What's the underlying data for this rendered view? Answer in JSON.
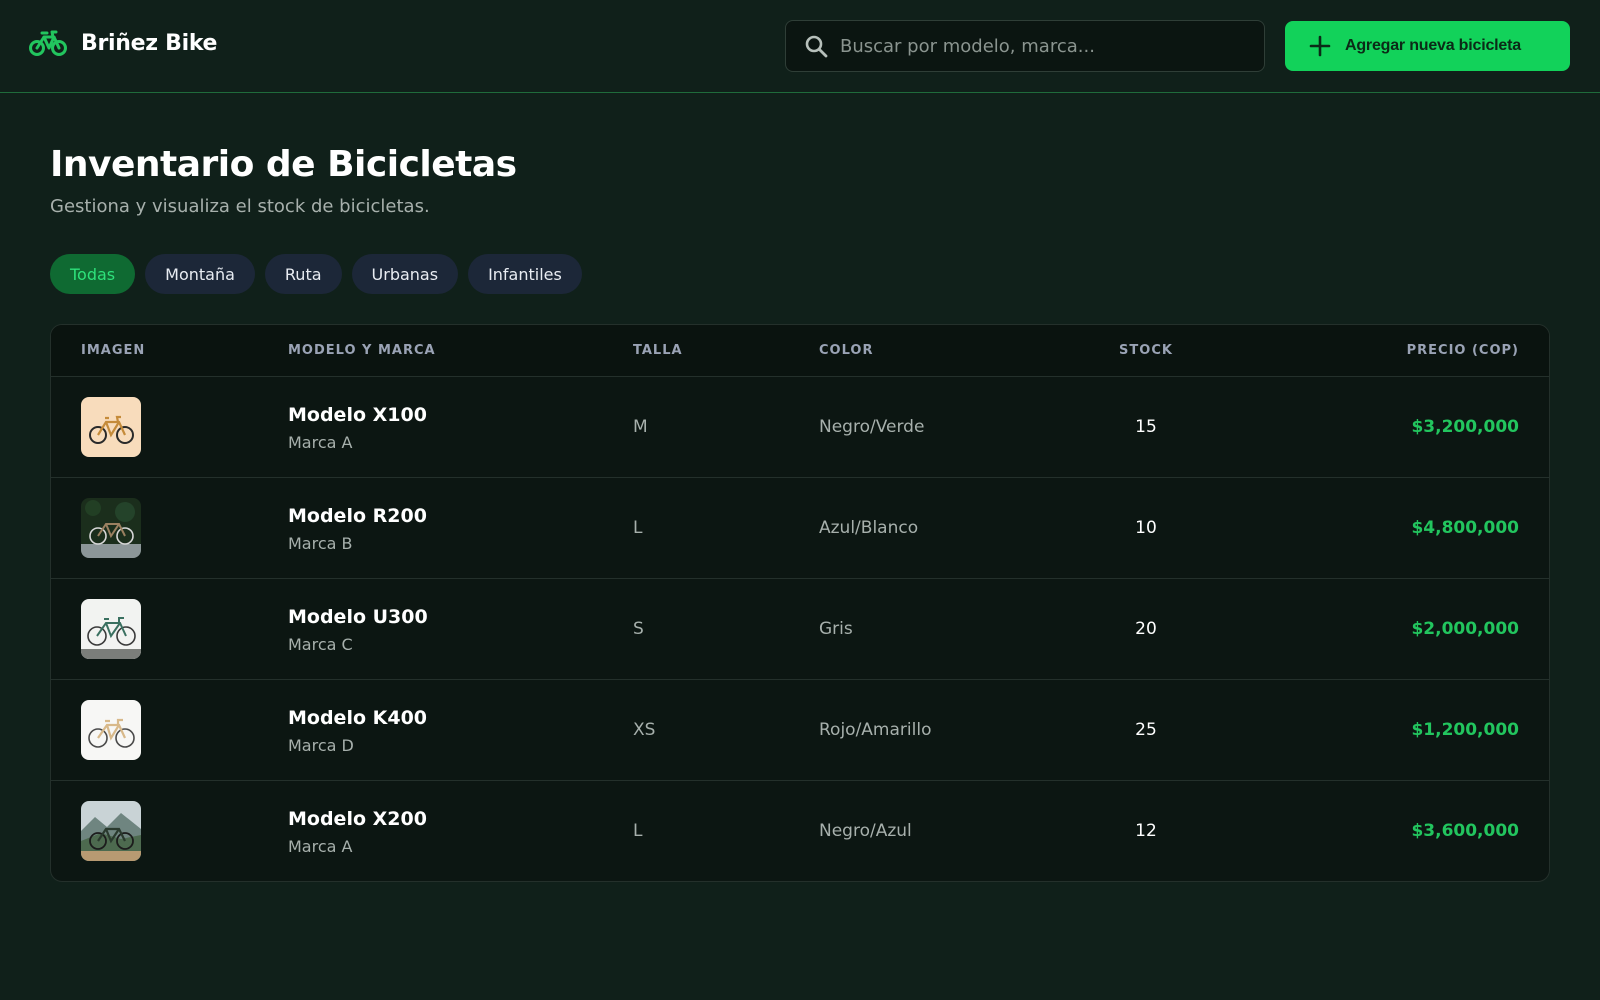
{
  "header": {
    "brand_name": "Briñez Bike",
    "brand_icon": "bicycle-icon",
    "search": {
      "placeholder": "Buscar por modelo, marca...",
      "value": ""
    },
    "add_button_label": "Agregar nueva bicicleta"
  },
  "page": {
    "title": "Inventario de Bicicletas",
    "subtitle": "Gestiona y visualiza el stock de bicicletas."
  },
  "filters": [
    {
      "label": "Todas",
      "active": true
    },
    {
      "label": "Montaña",
      "active": false
    },
    {
      "label": "Ruta",
      "active": false
    },
    {
      "label": "Urbanas",
      "active": false
    },
    {
      "label": "Infantiles",
      "active": false
    }
  ],
  "table": {
    "columns": [
      "IMAGEN",
      "MODELO Y MARCA",
      "TALLA",
      "COLOR",
      "STOCK",
      "PRECIO (COP)"
    ],
    "rows": [
      {
        "model": "Modelo X100",
        "brand": "Marca A",
        "size": "M",
        "color": "Negro/Verde",
        "stock": "15",
        "price": "$3,200,000"
      },
      {
        "model": "Modelo R200",
        "brand": "Marca B",
        "size": "L",
        "color": "Azul/Blanco",
        "stock": "10",
        "price": "$4,800,000"
      },
      {
        "model": "Modelo U300",
        "brand": "Marca C",
        "size": "S",
        "color": "Gris",
        "stock": "20",
        "price": "$2,000,000"
      },
      {
        "model": "Modelo K400",
        "brand": "Marca D",
        "size": "XS",
        "color": "Rojo/Amarillo",
        "stock": "25",
        "price": "$1,200,000"
      },
      {
        "model": "Modelo X200",
        "brand": "Marca A",
        "size": "L",
        "color": "Negro/Azul",
        "stock": "12",
        "price": "$3,600,000"
      }
    ]
  },
  "colors": {
    "accent": "#12d25a",
    "background": "#10201a",
    "price": "#22c55e"
  }
}
